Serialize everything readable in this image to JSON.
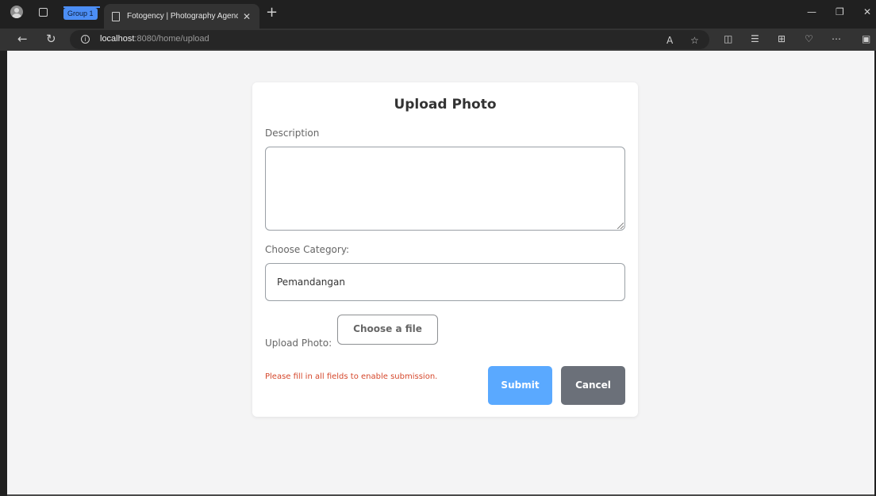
{
  "browser": {
    "group_label": "Group 1",
    "tab_title": "Fotogency | Photography Agency",
    "url_host": "localhost",
    "url_path": ":8080/home/upload",
    "accent": "#4c8ef5"
  },
  "form": {
    "title": "Upload Photo",
    "description_label": "Description",
    "description_value": "",
    "category_label": "Choose Category:",
    "category_selected": "Pemandangan",
    "upload_label": "Upload Photo:",
    "file_button_label": "Choose a file",
    "validation_hint": "Please fill in all fields to enable submission.",
    "submit_label": "Submit",
    "cancel_label": "Cancel",
    "colors": {
      "submit": "#5aa9ff",
      "cancel": "#6b7079",
      "hint": "#d5472b"
    }
  }
}
